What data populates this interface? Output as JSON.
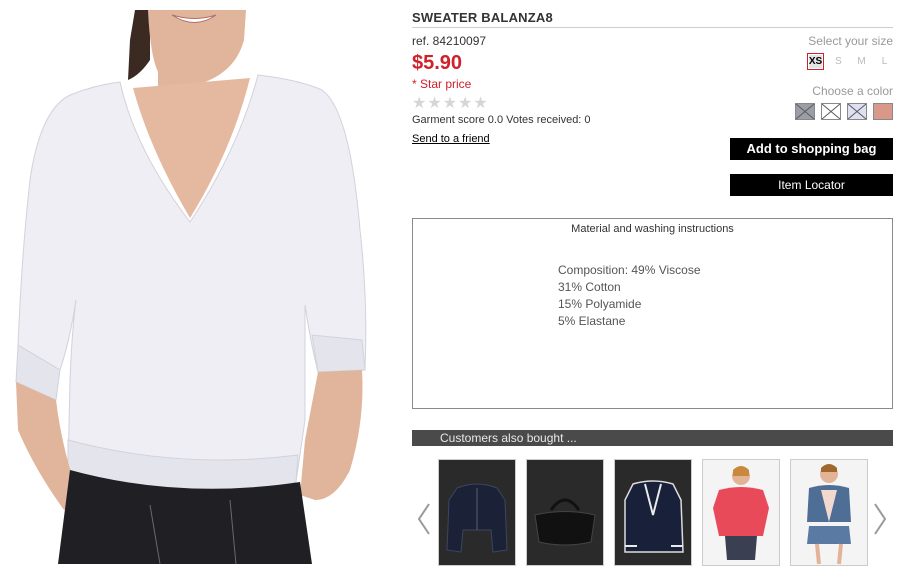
{
  "product": {
    "title": "SWEATER BALANZA8",
    "ref": "ref. 84210097",
    "price": "$5.90",
    "star_price": "* Star price",
    "rating": 0,
    "score_text": "Garment score 0.0 Votes received: 0",
    "send_to_friend": "Send to a friend"
  },
  "size_selector": {
    "label": "Select your size",
    "options": [
      "XS",
      "S",
      "M",
      "L"
    ],
    "selected": "XS"
  },
  "color_selector": {
    "label": "Choose a color",
    "swatches": [
      {
        "color": "#9a9ea6"
      },
      {
        "color": "#ffffff"
      },
      {
        "color": "#dfe1f2"
      },
      {
        "color": "#d9988a"
      }
    ]
  },
  "actions": {
    "add_to_bag": "Add to shopping bag",
    "item_locator": "Item Locator"
  },
  "material": {
    "title": "Material and washing instructions",
    "lines": [
      "Composition: 49% Viscose",
      "31% Cotton",
      "15% Polyamide",
      "5% Elastane"
    ]
  },
  "also_bought": {
    "title": "Customers also bought ...",
    "items": [
      {
        "icon": "navy-jacket-image"
      },
      {
        "icon": "black-bag-image"
      },
      {
        "icon": "navy-blazer-image"
      },
      {
        "icon": "coral-jacket-image"
      },
      {
        "icon": "denim-vest-image"
      }
    ]
  },
  "colors": {
    "price_red": "#d0202a",
    "button_black": "#000000",
    "bar_gray": "#4a4a4a"
  }
}
